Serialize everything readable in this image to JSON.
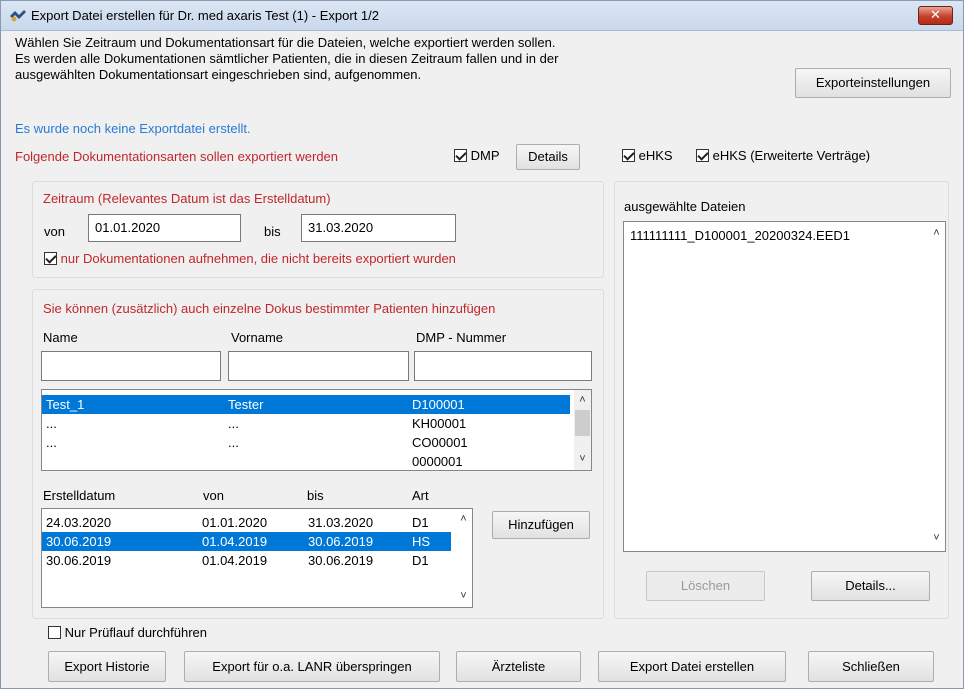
{
  "window": {
    "title": "Export Datei erstellen für Dr. med axaris Test (1)  -  Export 1/2",
    "close_label": "✕"
  },
  "intro": {
    "line1": "Wählen Sie Zeitraum und Dokumentationsart für die Dateien, welche exportiert werden sollen.",
    "line2": "Es werden alle Dokumentationen sämtlicher Patienten, die in diesen Zeitraum fallen und in der",
    "line3": "ausgewählten Dokumentationsart eingeschrieben sind, aufgenommen.",
    "status": "Es wurde noch keine Exportdatei erstellt."
  },
  "buttons": {
    "export_settings": "Exporteinstellungen",
    "details": "Details",
    "add": "Hinzufügen",
    "delete": "Löschen",
    "details_files": "Details...",
    "export_history": "Export Historie",
    "skip_lanr": "Export für o.a. LANR überspringen",
    "doctor_list": "Ärzteliste",
    "create_export": "Export Datei erstellen",
    "close": "Schließen"
  },
  "doc_types": {
    "label": "Folgende Dokumentationsarten sollen exportiert werden",
    "dmp": "DMP",
    "ehks": "eHKS",
    "ehks_ext": "eHKS (Erweiterte Verträge)"
  },
  "period": {
    "heading": "Zeitraum (Relevantes Datum ist das Erstelldatum)",
    "from_label": "von",
    "from_value": "01.01.2020",
    "to_label": "bis",
    "to_value": "31.03.2020",
    "only_new_label": "nur Dokumentationen aufnehmen, die nicht bereits exportiert wurden"
  },
  "patients": {
    "heading": "Sie können (zusätzlich) auch einzelne Dokus bestimmter Patienten hinzufügen",
    "col_name": "Name",
    "col_firstname": "Vorname",
    "col_dmp": "DMP - Nummer",
    "name_value": "",
    "firstname_value": "",
    "dmp_value": "",
    "rows": [
      {
        "name": "Test_1",
        "firstname": "Tester",
        "dmp": "D100001"
      },
      {
        "name": "...",
        "firstname": "...",
        "dmp": "KH00001"
      },
      {
        "name": "...",
        "firstname": "...",
        "dmp": "CO00001"
      },
      {
        "name": "",
        "firstname": "",
        "dmp": "0000001"
      }
    ]
  },
  "docs": {
    "col_created": "Erstelldatum",
    "col_from": "von",
    "col_to": "bis",
    "col_type": "Art",
    "rows": [
      {
        "created": "24.03.2020",
        "from": "01.01.2020",
        "to": "31.03.2020",
        "type": "D1"
      },
      {
        "created": "30.06.2019",
        "from": "01.04.2019",
        "to": "30.06.2019",
        "type": "HS"
      },
      {
        "created": "30.06.2019",
        "from": "01.04.2019",
        "to": "30.06.2019",
        "type": "D1"
      }
    ]
  },
  "files": {
    "heading": "ausgewählte Dateien",
    "items": [
      "111111111_D100001_20200324.EED1"
    ]
  },
  "footer": {
    "test_run_label": "Nur Prüflauf durchführen"
  },
  "checks": {
    "dmp": true,
    "ehks": true,
    "ehks_ext": true,
    "only_new": true,
    "test_run": false
  }
}
